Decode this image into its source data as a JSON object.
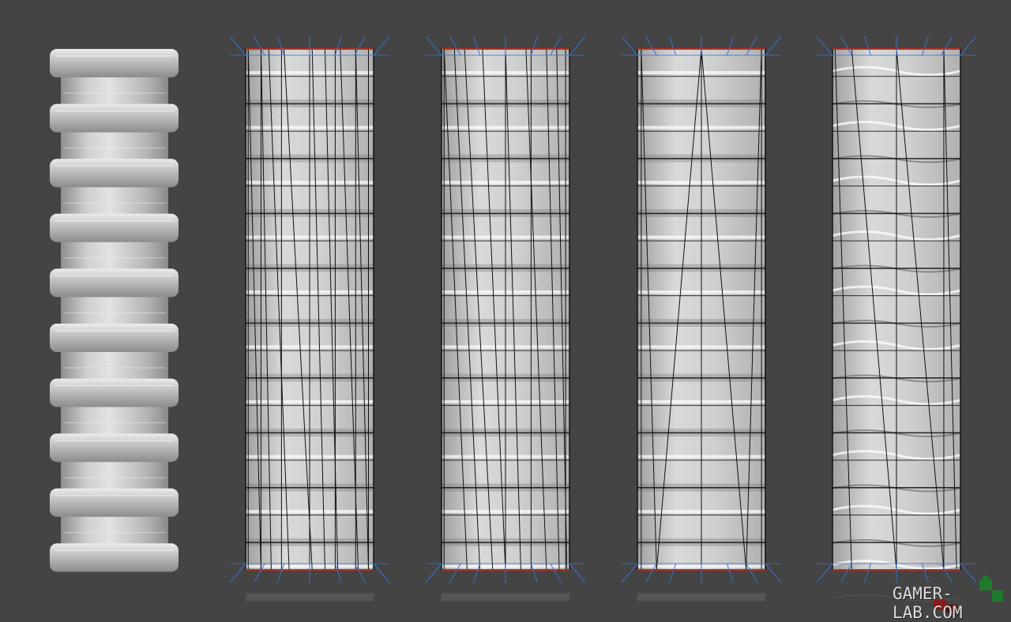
{
  "scene": {
    "background": "#444444",
    "panels": [
      {
        "name": "smooth-model-preview",
        "view": "shaded"
      },
      {
        "name": "wireframe-even-spokes",
        "view": "wireframe"
      },
      {
        "name": "wireframe-uneven-spokes",
        "view": "wireframe"
      },
      {
        "name": "wireframe-sparse-spokes",
        "view": "wireframe"
      },
      {
        "name": "wireframe-minimal-spokes",
        "view": "wireframe"
      }
    ],
    "colors": {
      "mesh_shade_dark": "#8a8a8a",
      "mesh_shade_light": "#d8d8d8",
      "edge": "#111111",
      "normal_lines": "#3a6fd0",
      "open_edge": "#b03020"
    }
  },
  "watermark": {
    "text": "GAMER-LAB.COM",
    "logo_icon": "puzzle-piece-icon"
  }
}
